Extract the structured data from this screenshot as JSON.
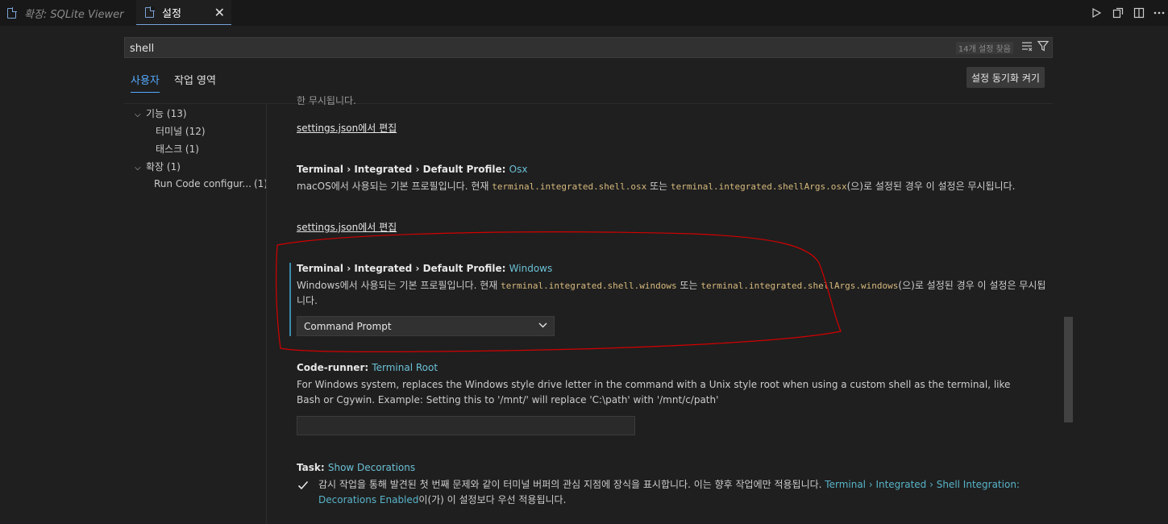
{
  "tabs": [
    {
      "label": "확장: SQLite Viewer",
      "active": false
    },
    {
      "label": "설정",
      "active": true,
      "close": "✕"
    }
  ],
  "toolbar_icons": [
    "run-icon",
    "open-json-icon",
    "split-editor-icon",
    "more-icon"
  ],
  "search": {
    "value": "shell",
    "count": "14개 설정 찾음",
    "clear_icon": "clear-filter-icon",
    "filter_icon": "filter-icon"
  },
  "scope_tabs": [
    "사용자",
    "작업 영역"
  ],
  "sync_button": "설정 동기화 켜기",
  "toc": [
    {
      "label": "기능 (13)",
      "expanded": true,
      "level": 0
    },
    {
      "label": "터미널 (12)",
      "level": 1
    },
    {
      "label": "태스크 (1)",
      "level": 1
    },
    {
      "label": "확장 (1)",
      "expanded": true,
      "level": 0
    },
    {
      "label": "Run Code configur...",
      "count": "(1)",
      "level": 1
    }
  ],
  "settings": {
    "partial_top": "한 무시됩니다.",
    "edit_link_1": "settings.json에서 편집",
    "osx": {
      "prefix": "Terminal › Integrated › Default Profile: ",
      "key": "Osx",
      "desc_a": "macOS에서 사용되는 기본 프로필입니다. 현재 ",
      "code_a": "terminal.integrated.shell.osx",
      "desc_b": " 또는 ",
      "code_b": "terminal.integrated.shellArgs.osx",
      "desc_c": "(으)로 설정된 경우 이 설정은 무시됩니다.",
      "edit_link": "settings.json에서 편집"
    },
    "windows": {
      "prefix": "Terminal › Integrated › Default Profile: ",
      "key": "Windows",
      "desc_a": "Windows에서 사용되는 기본 프로필입니다. 현재 ",
      "code_a": "terminal.integrated.shell.windows",
      "desc_b": " 또는 ",
      "code_b": "terminal.integrated.shellArgs.windows",
      "desc_c": "(으)로 설정된 경우 이 설정은 무시됩니다.",
      "selected": "Command Prompt"
    },
    "code_runner": {
      "prefix": "Code-runner: ",
      "key": "Terminal Root",
      "desc": "For Windows system, replaces the Windows style drive letter in the command with a Unix style root when using a custom shell as the terminal, like Bash or Cgywin. Example: Setting this to '/mnt/' will replace 'C:\\path' with '/mnt/c/path'",
      "value": ""
    },
    "task": {
      "prefix": "Task: ",
      "key": "Show Decorations",
      "checked": true,
      "desc_a": "감시 작업을 통해 발견된 첫 번째 문제와 같이 터미널 버퍼의 관심 지점에 장식을 표시합니다. 이는 향후 작업에만 적용됩니다. ",
      "link": "Terminal › Integrated › Shell Integration: Decorations Enabled",
      "desc_b": "이(가) 이 설정보다 우선 적용됩니다."
    }
  },
  "colors": {
    "accent": "#55aaff",
    "setting_key": "#58b4c9",
    "code": "#d7ba7d",
    "annotation": "#d40000"
  }
}
